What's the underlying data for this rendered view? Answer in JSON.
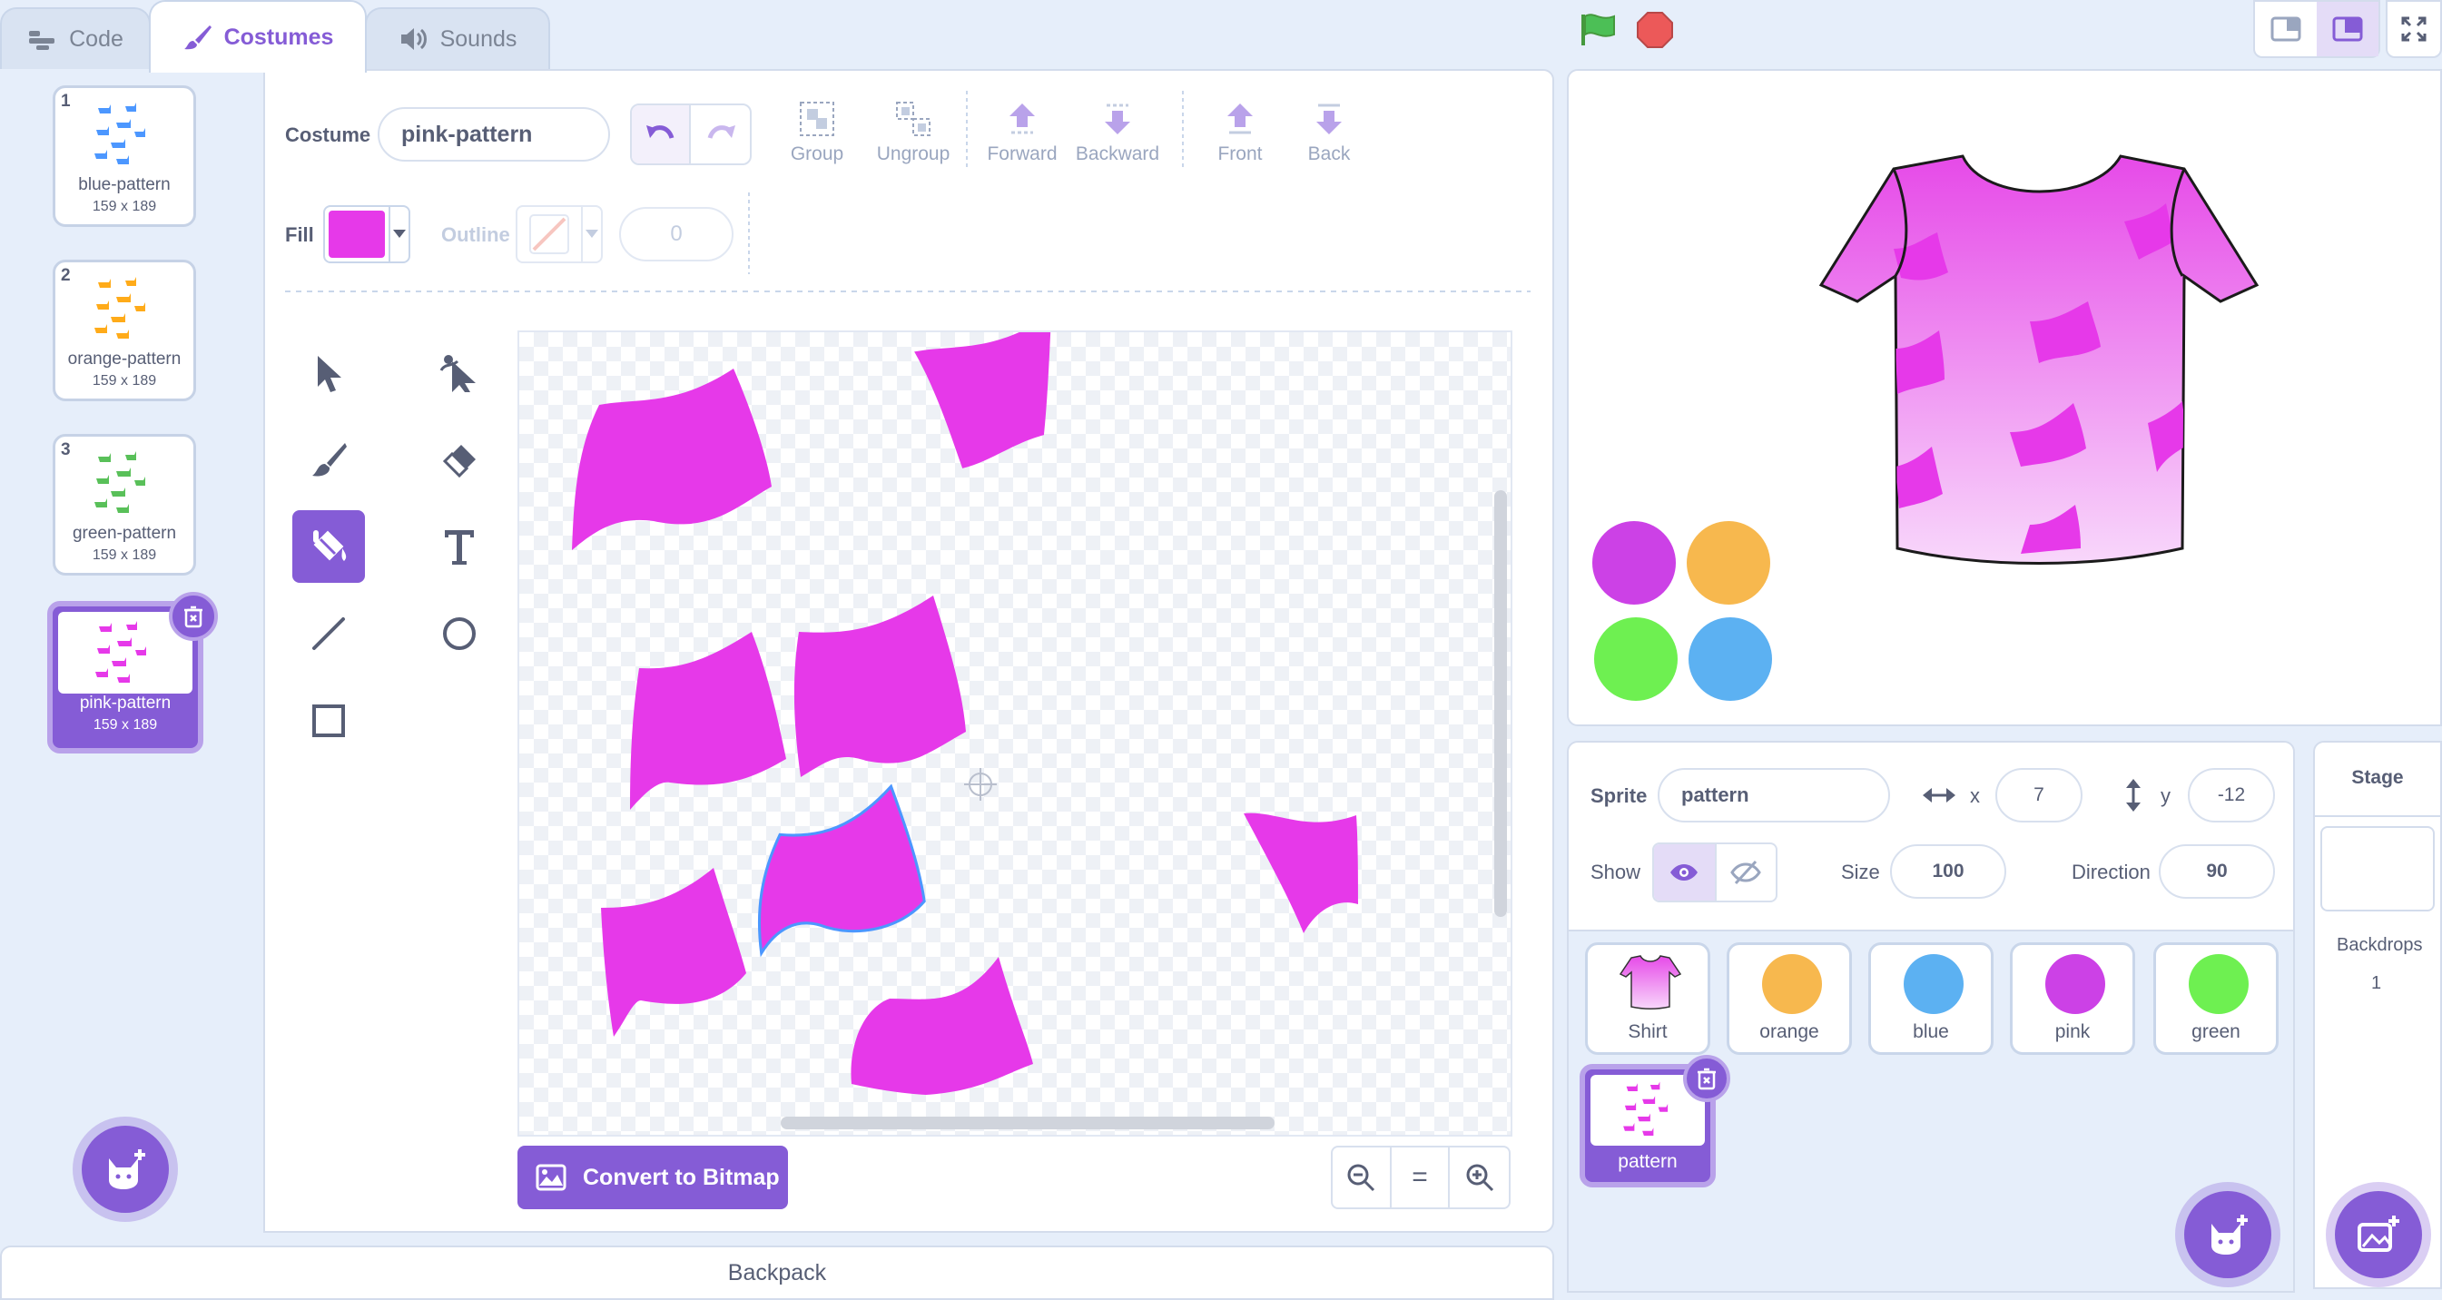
{
  "tabs": {
    "code": "Code",
    "costumes": "Costumes",
    "sounds": "Sounds"
  },
  "costumes": [
    {
      "num": "1",
      "name": "blue-pattern",
      "size": "159 x 189",
      "color": "#4c97ff"
    },
    {
      "num": "2",
      "name": "orange-pattern",
      "size": "159 x 189",
      "color": "#ffab19"
    },
    {
      "num": "3",
      "name": "green-pattern",
      "size": "159 x 189",
      "color": "#59c059"
    },
    {
      "num": "4",
      "name": "pink-pattern",
      "size": "159 x 189",
      "color": "#e639e9"
    }
  ],
  "editor": {
    "costume_label": "Costume",
    "costume_name": "pink-pattern",
    "group": "Group",
    "ungroup": "Ungroup",
    "forward": "Forward",
    "backward": "Backward",
    "front": "Front",
    "back": "Back",
    "fill_label": "Fill",
    "outline_label": "Outline",
    "outline_width": "0",
    "fill_color": "#e639e9",
    "convert": "Convert to Bitmap",
    "zoom_reset": "="
  },
  "backpack": "Backpack",
  "sprite_info": {
    "sprite_label": "Sprite",
    "sprite_name": "pattern",
    "x_label": "x",
    "x": "7",
    "y_label": "y",
    "y": "-12",
    "show_label": "Show",
    "size_label": "Size",
    "size": "100",
    "direction_label": "Direction",
    "direction": "90"
  },
  "sprites": [
    {
      "name": "Shirt"
    },
    {
      "name": "orange",
      "color": "#f7b84e"
    },
    {
      "name": "blue",
      "color": "#5cb1f2"
    },
    {
      "name": "pink",
      "color": "#cc41e6"
    },
    {
      "name": "green",
      "color": "#6ef051"
    },
    {
      "name": "pattern"
    }
  ],
  "stage": {
    "label": "Stage",
    "backdrops_label": "Backdrops",
    "backdrops_count": "1"
  },
  "stage_colors": [
    "#cc41e6",
    "#f7b84e",
    "#6ef051",
    "#5cb1f2"
  ]
}
